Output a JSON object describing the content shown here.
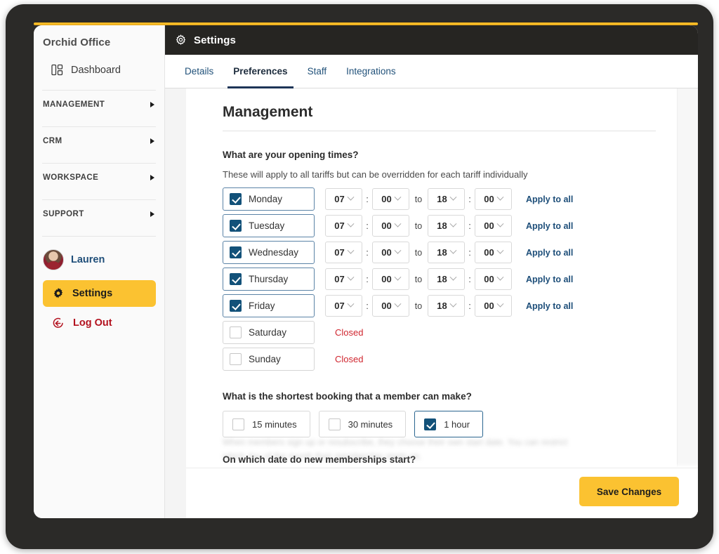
{
  "sidebar": {
    "brand": "Orchid Office",
    "dashboard": {
      "label": "Dashboard",
      "icon": "dashboard-layout-icon"
    },
    "groups": [
      {
        "label": "MANAGEMENT",
        "icon": "caret-right-icon"
      },
      {
        "label": "CRM",
        "icon": "caret-right-icon"
      },
      {
        "label": "WORKSPACE",
        "icon": "caret-right-icon"
      },
      {
        "label": "SUPPORT",
        "icon": "caret-right-icon"
      }
    ],
    "user": {
      "name": "Lauren",
      "avatar_icon": "user-avatar"
    },
    "settings": {
      "label": "Settings",
      "icon": "gear-icon"
    },
    "logout": {
      "label": "Log Out",
      "icon": "logout-arrow-icon"
    }
  },
  "header": {
    "title": "Settings",
    "icon": "gear-icon"
  },
  "tabs": [
    {
      "label": "Details",
      "active": false
    },
    {
      "label": "Preferences",
      "active": true
    },
    {
      "label": "Staff",
      "active": false
    },
    {
      "label": "Integrations",
      "active": false
    }
  ],
  "main": {
    "page_title": "Management",
    "opening_times": {
      "question": "What are your opening times?",
      "help": "These will apply to all tariffs but can be overridden for each tariff individually",
      "to_label": "to",
      "colon": ":",
      "apply_all_label": "Apply to all",
      "closed_label": "Closed",
      "days": [
        {
          "name": "Monday",
          "checked": true,
          "open_h": "07",
          "open_m": "00",
          "close_h": "18",
          "close_m": "00"
        },
        {
          "name": "Tuesday",
          "checked": true,
          "open_h": "07",
          "open_m": "00",
          "close_h": "18",
          "close_m": "00"
        },
        {
          "name": "Wednesday",
          "checked": true,
          "open_h": "07",
          "open_m": "00",
          "close_h": "18",
          "close_m": "00"
        },
        {
          "name": "Thursday",
          "checked": true,
          "open_h": "07",
          "open_m": "00",
          "close_h": "18",
          "close_m": "00"
        },
        {
          "name": "Friday",
          "checked": true,
          "open_h": "07",
          "open_m": "00",
          "close_h": "18",
          "close_m": "00"
        },
        {
          "name": "Saturday",
          "checked": false,
          "open_h": "",
          "open_m": "",
          "close_h": "",
          "close_m": ""
        },
        {
          "name": "Sunday",
          "checked": false,
          "open_h": "",
          "open_m": "",
          "close_h": "",
          "close_m": ""
        }
      ]
    },
    "shortest_booking": {
      "question": "What is the shortest booking that a member can make?",
      "options": [
        {
          "label": "15 minutes",
          "checked": false
        },
        {
          "label": "30 minutes",
          "checked": false
        },
        {
          "label": "1 hour",
          "checked": true
        }
      ]
    },
    "membership_start": {
      "question": "On which date do new memberships start?",
      "note": "When members sign up or resubscribe, they choose their own start date. You can restrict which day of the month their membership starts on."
    }
  },
  "footer": {
    "save_label": "Save Changes"
  },
  "colors": {
    "accent_yellow": "#fbc231",
    "checkbox_blue": "#125179",
    "link_blue": "#1d4e79",
    "closed_red": "#d0262f",
    "logout_red": "#b3121f",
    "topbar_dark": "#262522",
    "tab_underline": "#1d3557"
  }
}
